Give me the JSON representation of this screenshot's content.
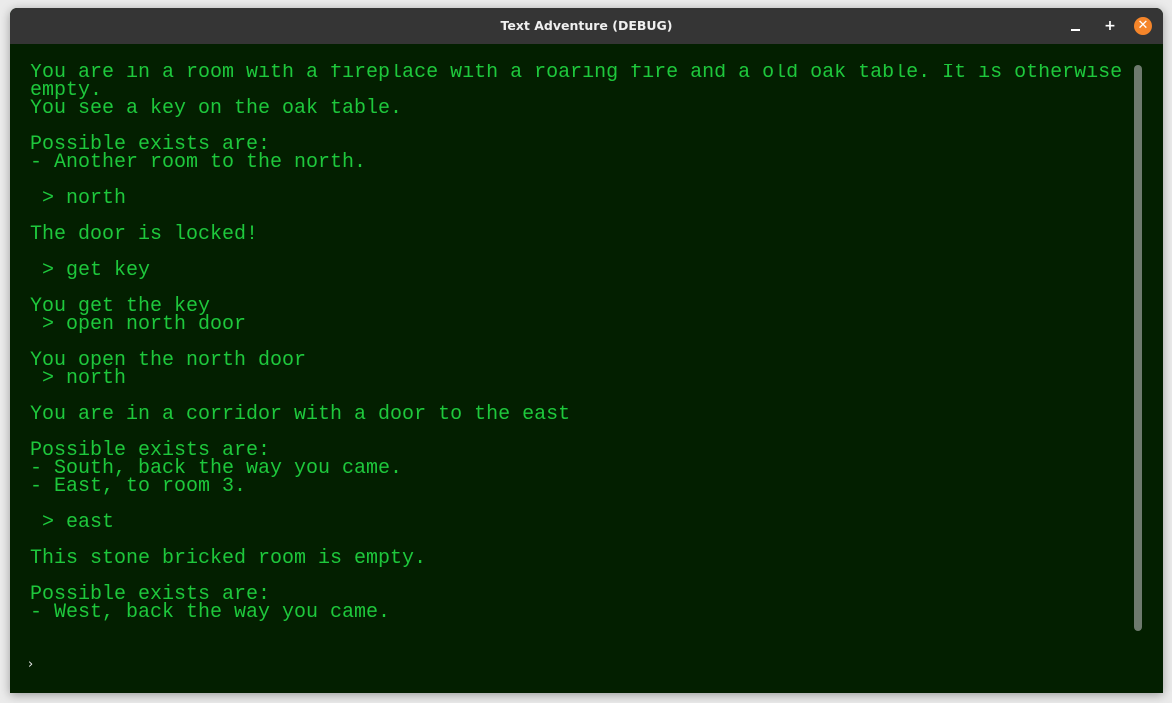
{
  "window": {
    "title": "Text Adventure (DEBUG)",
    "controls": {
      "minimize_icon": "minimize-icon",
      "maximize_label": "+",
      "close_label": "✕"
    }
  },
  "terminal": {
    "text_color": "#1ec83c",
    "background_color": "#031f00",
    "lines": [
      "You are in a room with a fireplace with a roaring fire and a old oak table. It is otherwise",
      "empty.",
      "You see a key on the oak table.",
      "",
      "Possible exists are:",
      "- Another room to the north.",
      "",
      " > north",
      "",
      "The door is locked!",
      "",
      " > get key",
      "",
      "You get the key",
      " > open north door",
      "",
      "You open the north door",
      " > north",
      "",
      "You are in a corridor with a door to the east",
      "",
      "Possible exists are:",
      "- South, back the way you came.",
      "- East, to room 3.",
      "",
      " > east",
      "",
      "This stone bricked room is empty.",
      "",
      "Possible exists are:",
      "- West, back the way you came."
    ]
  },
  "input": {
    "prompt": "›",
    "value": "",
    "placeholder": ""
  }
}
